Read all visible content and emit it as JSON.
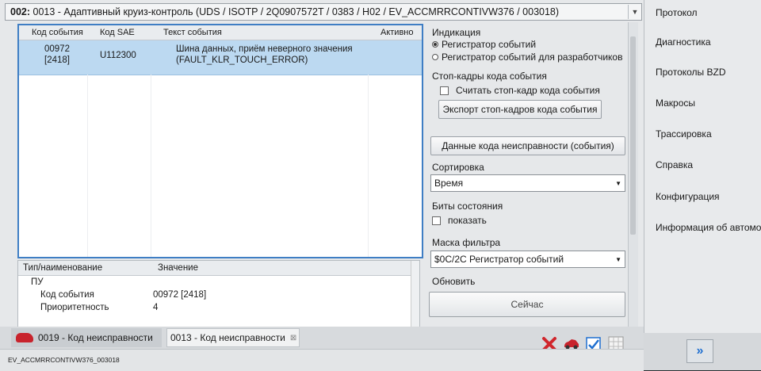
{
  "title": {
    "code": "002:",
    "text": "0013 - Адаптивный круиз-контроль  (UDS / ISOTP / 2Q0907572T / 0383 / H02 / EV_ACCMRRCONTIVW376 / 003018)"
  },
  "events_table": {
    "headers": [
      "Код события",
      "Код SAE",
      "Текст события",
      "Активно"
    ],
    "rows": [
      {
        "code": "00972",
        "code_sub": "[2418]",
        "sae": "U112300",
        "text": "Шина данных, приём неверного значения",
        "text_sub": "(FAULT_KLR_TOUCH_ERROR)",
        "active": ""
      }
    ]
  },
  "properties": {
    "headers": [
      "Тип/наименование",
      "Значение"
    ],
    "rows": [
      {
        "key": "ПУ",
        "value": ""
      },
      {
        "key": "Код события",
        "value": "00972 [2418]"
      },
      {
        "key": "Приоритетность",
        "value": "4"
      }
    ]
  },
  "panel": {
    "indication_label": "Индикация",
    "radio_event_recorder": "Регистратор событий",
    "radio_dev_recorder": "Регистратор событий для разработчиков",
    "freeze_frames_label": "Стоп-кадры кода события",
    "read_freeze_frame": "Считать стоп-кадр кода события",
    "export_button": "Экспорт стоп-кадров кода события",
    "fault_data_button": "Данные кода неисправности (события)",
    "sort_label": "Сортировка",
    "sort_value": "Время",
    "status_bits_label": "Биты состояния",
    "show_label": "показать",
    "filter_mask_label": "Маска фильтра",
    "filter_mask_value": "$0C/2C Регистратор событий",
    "update_label": "Обновить",
    "now_button": "Сейчас"
  },
  "side_menu": [
    "Протокол",
    "Диагностика",
    "Протоколы BZD",
    "Макросы",
    "Трассировка",
    "Справка",
    "Конфигурация",
    "Информация об автомо"
  ],
  "tabs": [
    {
      "label": "0019 - Код неисправности"
    },
    {
      "label": "0013 - Код неисправности",
      "close": "⊠"
    }
  ],
  "status_text": "EV_ACCMRRCONTIVW376_003018",
  "colors": {
    "selection": "#bcd9f1",
    "accent": "#3f7ec4",
    "delete": "#d0262c",
    "car": "#c8232c",
    "forward": "#1f6fd0"
  },
  "icons": [
    "car-icon",
    "delete-icon",
    "car-small-icon",
    "checklist-icon",
    "grid-icon",
    "forward-icon"
  ]
}
